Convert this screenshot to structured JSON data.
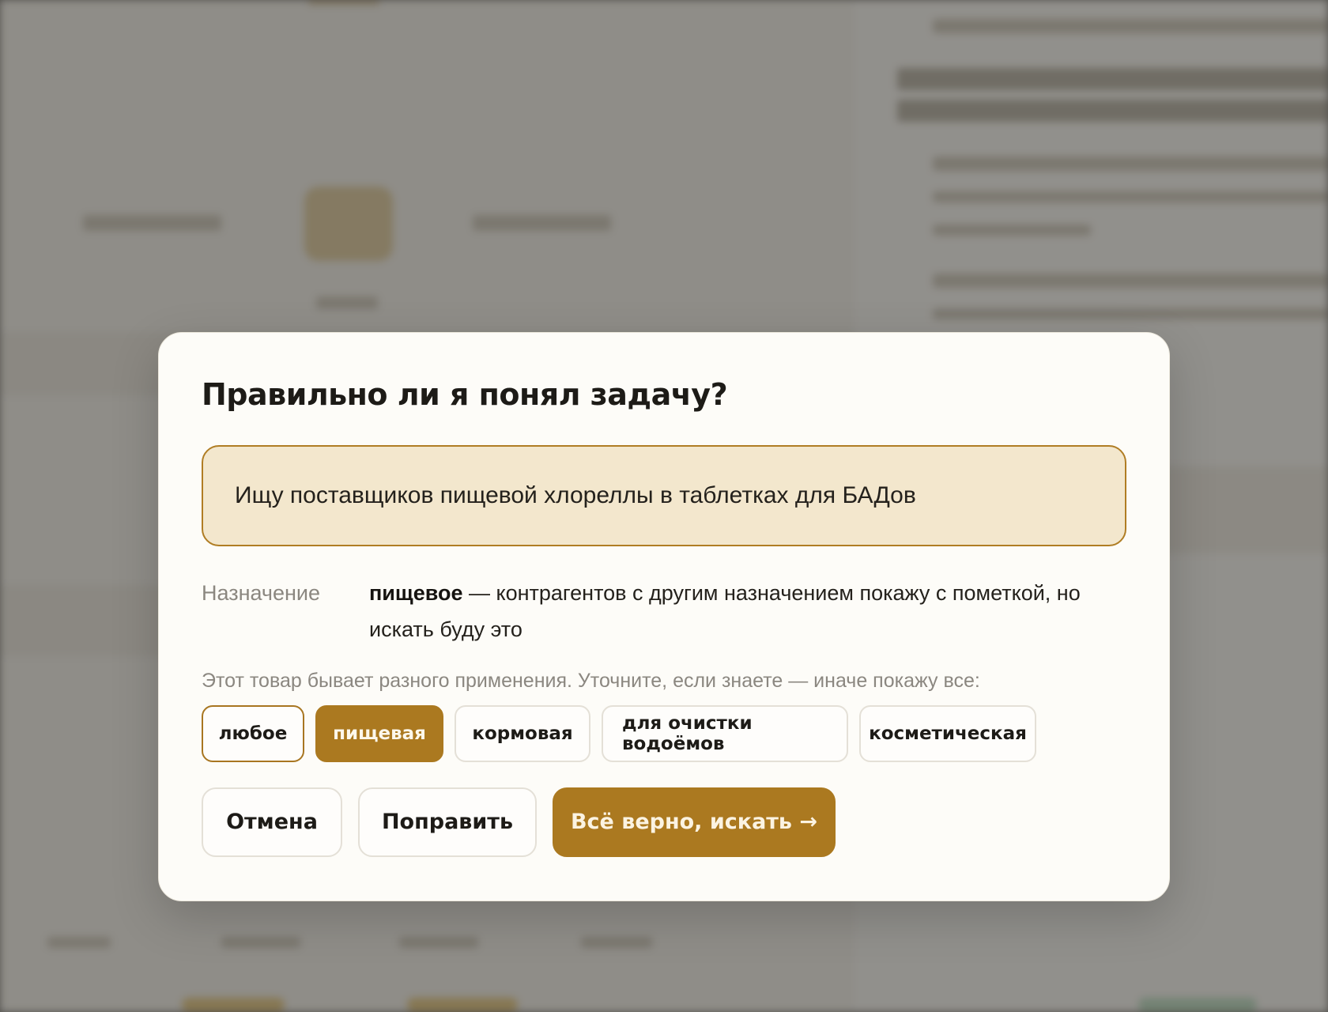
{
  "modal": {
    "title": "Правильно ли я понял задачу?",
    "query": "Ищу поставщиков пищевой хлореллы в таблетках для БАДов",
    "purpose_label": "Назначение",
    "purpose_value": "пищевое",
    "purpose_note": " — контрагентов с другим назначением покажу с пометкой, но искать буду это",
    "hint": "Этот товар бывает разного применения. Уточните, если знаете — иначе покажу все:",
    "options": [
      {
        "label": "любое",
        "state": "outlined"
      },
      {
        "label": "пищевая",
        "state": "selected"
      },
      {
        "label": "кормовая",
        "state": "default"
      },
      {
        "label": "для очистки водоёмов",
        "state": "default"
      },
      {
        "label": "косметическая",
        "state": "default"
      }
    ],
    "buttons": {
      "cancel": "Отмена",
      "edit": "Поправить",
      "confirm": "Всё верно, искать →"
    }
  },
  "colors": {
    "accent": "#ab7920",
    "query_background": "#f3e7cd",
    "modal_background": "#fdfcf8"
  }
}
